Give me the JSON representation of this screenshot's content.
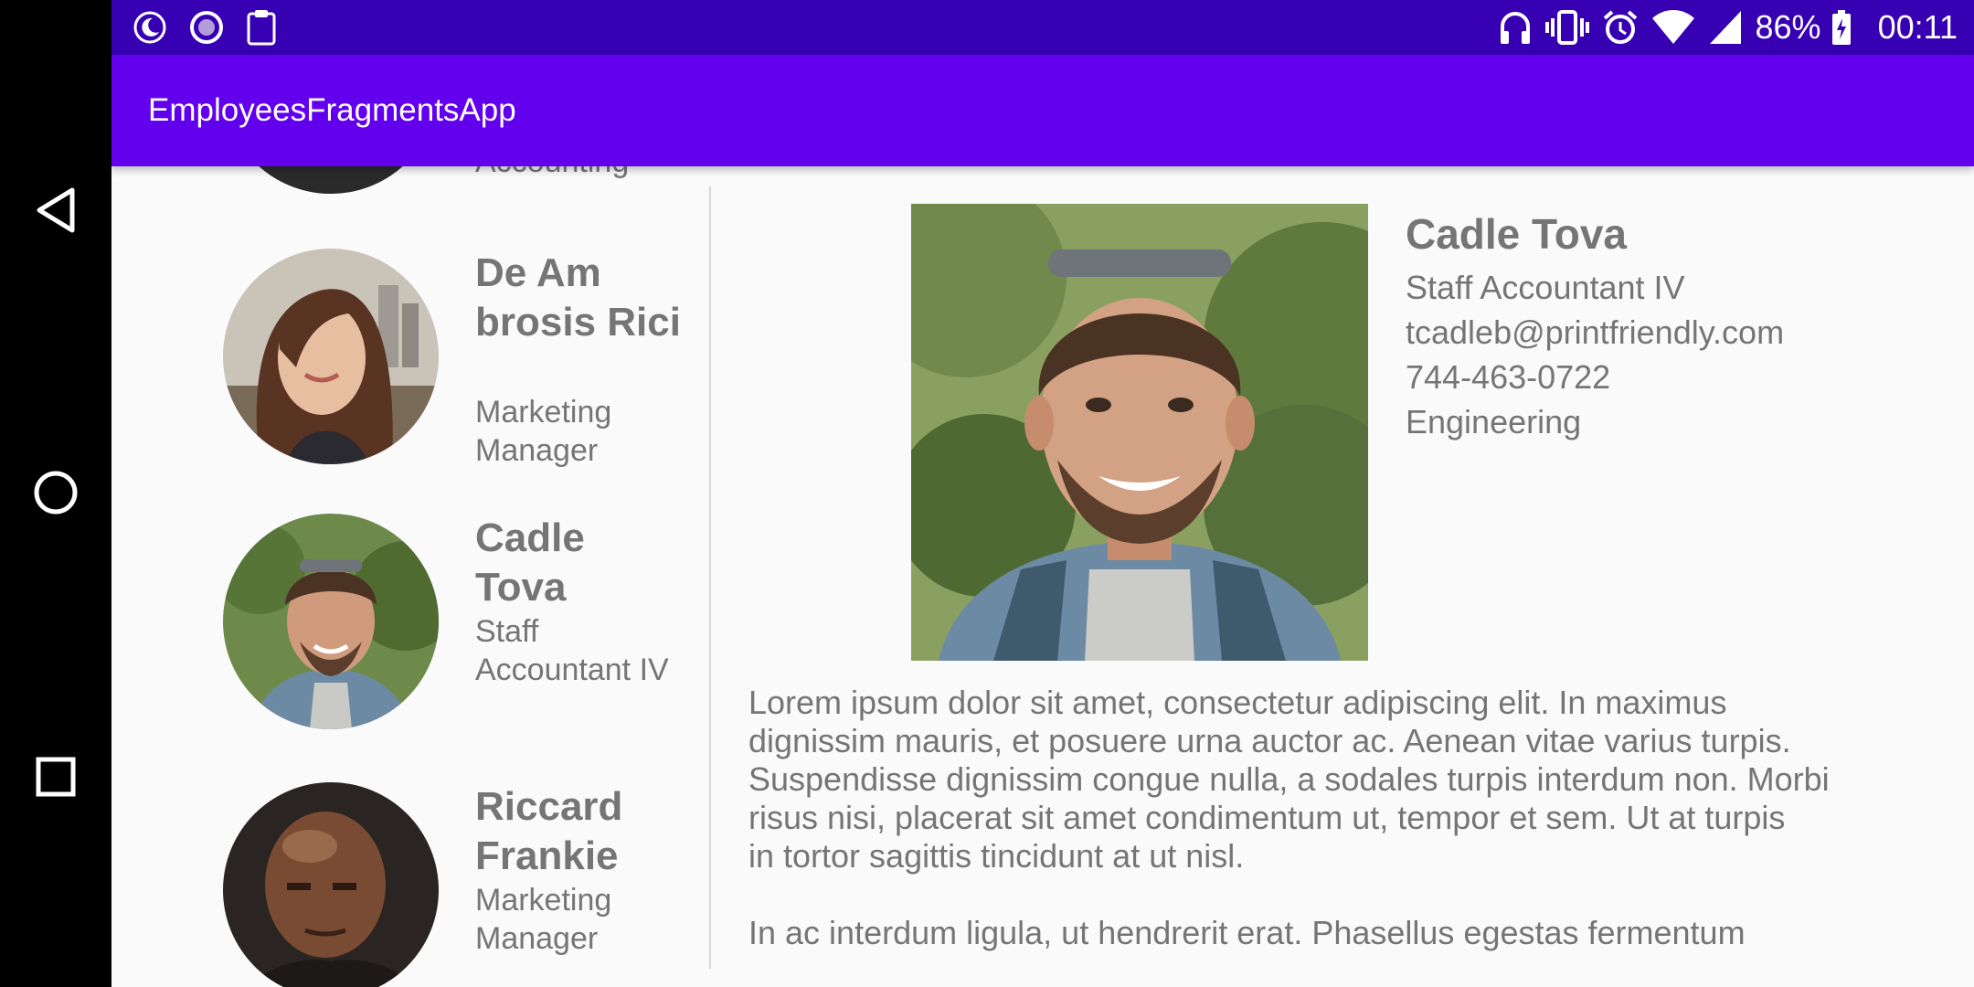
{
  "status_bar": {
    "left_icons": [
      "night-mode-icon",
      "record-icon",
      "clipboard-icon"
    ],
    "right_icons": [
      "headphones-icon",
      "vibrate-icon",
      "alarm-icon",
      "wifi-icon",
      "cell-signal-icon"
    ],
    "battery_percent": "86%",
    "time": "00:11"
  },
  "app_bar": {
    "title": "EmployeesFragmentsApp",
    "color": "#6200ee",
    "status_color": "#3700b3"
  },
  "navigation": {
    "icons": [
      "back-icon",
      "home-icon",
      "recents-icon"
    ]
  },
  "employee_list": {
    "partial_top_item": {
      "title": "Accounting"
    },
    "items": [
      {
        "name": "De Am brosis Rici",
        "title": "Marketing Manager"
      },
      {
        "name": "Cadle Tova",
        "title": "Staff Accountant IV"
      },
      {
        "name": "Riccard Frankie",
        "title": "Marketing Manager"
      }
    ]
  },
  "detail": {
    "name": "Cadle Tova",
    "job_title": "Staff Accountant IV",
    "email": "tcadleb@printfriendly.com",
    "phone": "744-463-0722",
    "department": "Engineering",
    "bio_paragraphs": [
      "Lorem ipsum dolor sit amet, consectetur adipiscing elit. In maximus\ndignissim mauris, et posuere urna auctor ac. Aenean vitae varius turpis.\nSuspendisse dignissim congue nulla, a sodales turpis interdum non. Morbi\nrisus nisi, placerat sit amet condimentum ut, tempor et sem. Ut at turpis\nin tortor sagittis tincidunt at ut nisl.",
      "In ac interdum ligula, ut hendrerit erat. Phasellus egestas fermentum"
    ]
  },
  "colors": {
    "text_secondary": "#757575",
    "background": "#fafafa"
  }
}
